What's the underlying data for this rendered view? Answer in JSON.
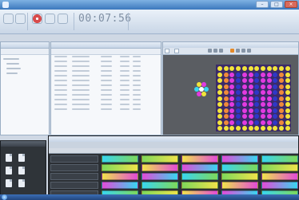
{
  "app": {
    "title": "",
    "timer": "00:07:56"
  },
  "window_buttons": {
    "minimize": "–",
    "maximize": "□",
    "close": "×"
  },
  "ribbon": {
    "groups": [
      "",
      "",
      ""
    ]
  },
  "preview": {
    "tabs": [
      "",
      ""
    ]
  },
  "colors": {
    "accent": "#3b78bd",
    "stage_magenta": "#e23be0",
    "stage_yellow": "#f2e43a",
    "stage_blue": "#2f38c7",
    "clip_cyan": "#38d6f0",
    "clip_green": "#7ed85a",
    "clip_yellow": "#f0e34a",
    "clip_magenta": "#e24ad8"
  },
  "icons": {
    "app": "app-icon",
    "record": "record-icon",
    "start": "windows-start-icon"
  }
}
